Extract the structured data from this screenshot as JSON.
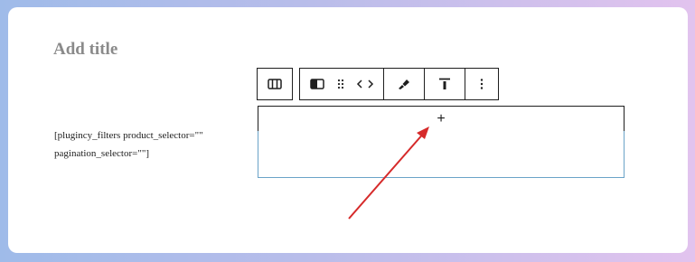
{
  "editor": {
    "title_placeholder": "Add title",
    "shortcode_lines": [
      "[plugincy_filters product_selector=\"\"",
      "pagination_selector=\"\"]"
    ]
  },
  "toolbar": {
    "icons": [
      "columns-icon",
      "block-type-icon",
      "drag-handle-icon",
      "move-arrows-icon",
      "brush-icon",
      "align-top-icon",
      "more-options-icon"
    ]
  },
  "appender": {
    "glyph": "+"
  },
  "colors": {
    "annotation_arrow": "#d62a2a",
    "block_border": "#6aa3c8",
    "title_gray": "#8a8a8a"
  }
}
